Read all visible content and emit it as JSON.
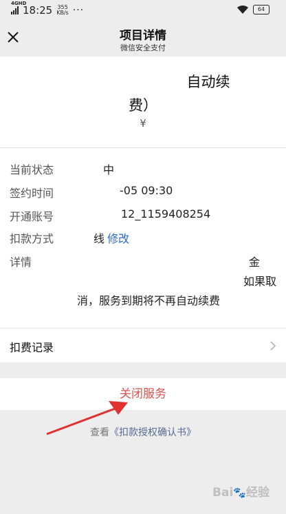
{
  "status_bar": {
    "network": "4GHD",
    "time": "18:25",
    "speed_value": "355",
    "speed_unit": "KB/s",
    "more": "···",
    "battery": "64"
  },
  "header": {
    "title": "项目详情",
    "subtitle": "微信安全支付"
  },
  "service": {
    "name_line1": "自动续",
    "name_line2": "费）",
    "amount": "¥"
  },
  "details": [
    {
      "label": "当前状态",
      "value": "中"
    },
    {
      "label": "签约时间",
      "value": "-05 09:30"
    },
    {
      "label": "开通账号",
      "value": "12_1159408254"
    },
    {
      "label": "扣款方式",
      "value": "线",
      "link": "修改"
    },
    {
      "label": "详情",
      "desc1": "金",
      "desc2": "如果取",
      "desc3": "消，服务到期将不再自动续费"
    }
  ],
  "deduct_record": {
    "label": "扣费记录"
  },
  "close_service": {
    "label": "关闭服务"
  },
  "auth_link": {
    "prefix": "查看",
    "book": "《扣款授权确认书》"
  },
  "watermark": {
    "text": "Bai",
    "suffix": "经验"
  },
  "colors": {
    "danger": "#d9534f",
    "link": "#2a6bd0",
    "arrow": "#e03030"
  }
}
